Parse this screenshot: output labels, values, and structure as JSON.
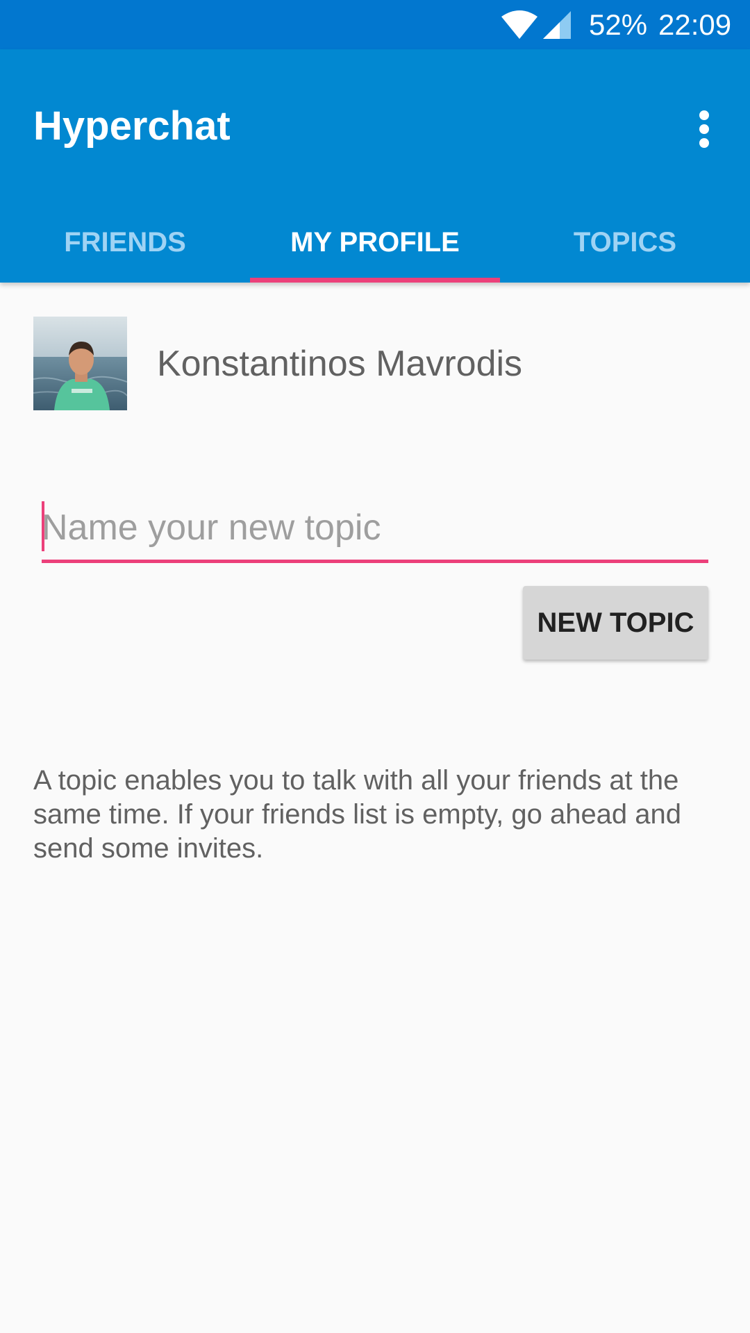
{
  "status_bar": {
    "battery": "52%",
    "time": "22:09",
    "icons": [
      "wifi-icon",
      "signal-icon"
    ]
  },
  "app_bar": {
    "title": "Hyperchat",
    "menu_icon": "more-vert-icon",
    "color": "#0288d1"
  },
  "tabs": [
    {
      "label": "FRIENDS",
      "active": false
    },
    {
      "label": "MY PROFILE",
      "active": true
    },
    {
      "label": "TOPICS",
      "active": false
    }
  ],
  "profile": {
    "name": "Konstantinos Mavrodis"
  },
  "topic_input": {
    "placeholder": "Name your new topic",
    "value": ""
  },
  "new_topic_button": {
    "label": "NEW TOPIC"
  },
  "help_text": "A topic enables you to talk with all your friends at the same time. If your friends list is empty, go ahead and send some invites.",
  "colors": {
    "accent": "#ec407a",
    "primary": "#0288d1",
    "primary_dark": "#0277cf"
  }
}
